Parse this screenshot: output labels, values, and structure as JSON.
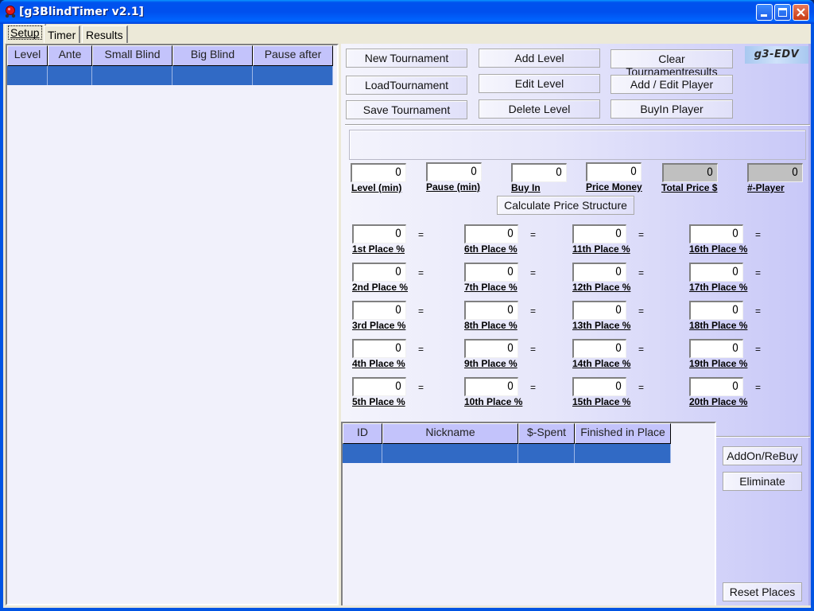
{
  "window": {
    "title": "[g3BlindTimer v2.1]",
    "icon": "poker-chip-icon",
    "controls": [
      "minimize",
      "maximize",
      "close"
    ]
  },
  "tabs": [
    {
      "label": "Setup",
      "accel": "S",
      "active": true
    },
    {
      "label": "Timer",
      "accel": "T",
      "active": false
    },
    {
      "label": "Results",
      "accel": "R",
      "active": false
    }
  ],
  "levels_table": {
    "columns": [
      "Level",
      "Ante",
      "Small Blind",
      "Big Blind",
      "Pause after"
    ],
    "rows": [
      [
        "",
        "",
        "",
        "",
        ""
      ]
    ]
  },
  "buttons": {
    "new_tournament": "New Tournament",
    "load_tournament": "LoadTournament",
    "save_tournament": "Save Tournament",
    "add_level": "Add Level",
    "edit_level": "Edit Level",
    "delete_level": "Delete Level",
    "clear_results": "Clear Tournamentresults",
    "add_edit_player": "Add / Edit Player",
    "buyin_player": "BuyIn Player",
    "calculate": "Calculate Price Structure",
    "addon_rebuy": "AddOn/ReBuy",
    "eliminate": "Eliminate",
    "reset_places": "Reset Places"
  },
  "logo": "g3-EDV",
  "settings": [
    {
      "label": "Level (min)",
      "value": "0",
      "readonly": false
    },
    {
      "label": "Pause (min)",
      "value": "0",
      "readonly": false
    },
    {
      "label": "Buy In",
      "value": "0",
      "readonly": false
    },
    {
      "label": "Price Money",
      "value": "0",
      "readonly": false
    },
    {
      "label": "Total Price $",
      "value": "0",
      "readonly": true
    },
    {
      "label": "#-Player",
      "value": "0",
      "readonly": true
    }
  ],
  "places": [
    {
      "label": "1st Place %",
      "value": "0",
      "eq": "="
    },
    {
      "label": "2nd Place %",
      "value": "0",
      "eq": "="
    },
    {
      "label": "3rd Place %",
      "value": "0",
      "eq": "="
    },
    {
      "label": "4th Place %",
      "value": "0",
      "eq": "="
    },
    {
      "label": "5th Place %",
      "value": "0",
      "eq": "="
    },
    {
      "label": "6th Place %",
      "value": "0",
      "eq": "="
    },
    {
      "label": "7th Place %",
      "value": "0",
      "eq": "="
    },
    {
      "label": "8th Place %",
      "value": "0",
      "eq": "="
    },
    {
      "label": "9th Place %",
      "value": "0",
      "eq": "="
    },
    {
      "label": "10th Place %",
      "value": "0",
      "eq": "="
    },
    {
      "label": "11th Place %",
      "value": "0",
      "eq": "="
    },
    {
      "label": "12th Place %",
      "value": "0",
      "eq": "="
    },
    {
      "label": "13th Place %",
      "value": "0",
      "eq": "="
    },
    {
      "label": "14th Place %",
      "value": "0",
      "eq": "="
    },
    {
      "label": "15th Place %",
      "value": "0",
      "eq": "="
    },
    {
      "label": "16th Place %",
      "value": "0",
      "eq": "="
    },
    {
      "label": "17th Place %",
      "value": "0",
      "eq": "="
    },
    {
      "label": "18th Place %",
      "value": "0",
      "eq": "="
    },
    {
      "label": "19th Place %",
      "value": "0",
      "eq": "="
    },
    {
      "label": "20th Place %",
      "value": "0",
      "eq": "="
    }
  ],
  "players_table": {
    "columns": [
      "ID",
      "Nickname",
      "$-Spent",
      "Finished in Place"
    ],
    "rows": [
      [
        "",
        "",
        "",
        ""
      ]
    ]
  },
  "colors": {
    "header_bg": "#c3c3fb",
    "selected_row": "#316ac5",
    "panel_gradient_end": "#c8c8f8"
  }
}
